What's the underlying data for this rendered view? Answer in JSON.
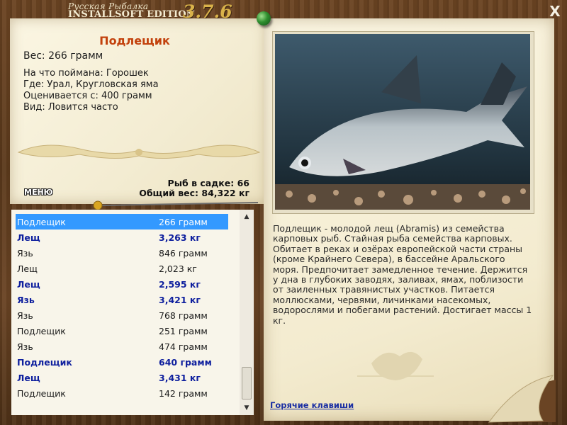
{
  "header": {
    "title_line1": "Русская Рыбалка",
    "title_line2": "INSTALLSOFT EDITION",
    "version": "3.7.6",
    "close": "X"
  },
  "catch": {
    "name": "Подлещик",
    "weight": "Вес: 266 грамм",
    "details": [
      "На что поймана: Горошек",
      "Где: Урал, Кругловская яма",
      "Оценивается с: 400 грамм",
      "Вид: Ловится часто"
    ]
  },
  "stats": {
    "fish_count": "Рыб в садке: 66",
    "total_weight": "Общий вес: 84,322 кг"
  },
  "menu_label": "МЕНЮ",
  "list": [
    {
      "name": "Подлещик",
      "weight": "266 грамм",
      "bold": false,
      "selected": true
    },
    {
      "name": "Лещ",
      "weight": "3,263 кг",
      "bold": true,
      "selected": false
    },
    {
      "name": "Язь",
      "weight": "846 грамм",
      "bold": false,
      "selected": false
    },
    {
      "name": "Лещ",
      "weight": "2,023 кг",
      "bold": false,
      "selected": false
    },
    {
      "name": "Лещ",
      "weight": "2,595 кг",
      "bold": true,
      "selected": false
    },
    {
      "name": "Язь",
      "weight": "3,421 кг",
      "bold": true,
      "selected": false
    },
    {
      "name": "Язь",
      "weight": "768 грамм",
      "bold": false,
      "selected": false
    },
    {
      "name": "Подлещик",
      "weight": "251 грамм",
      "bold": false,
      "selected": false
    },
    {
      "name": "Язь",
      "weight": "474 грамм",
      "bold": false,
      "selected": false
    },
    {
      "name": "Подлещик",
      "weight": "640 грамм",
      "bold": true,
      "selected": false
    },
    {
      "name": "Лещ",
      "weight": "3,431 кг",
      "bold": true,
      "selected": false
    },
    {
      "name": "Подлещик",
      "weight": "142 грамм",
      "bold": false,
      "selected": false
    }
  ],
  "description": "Подлещик - молодой лещ (Abramis) из семейства карповых рыб. Стайная рыба семейства карповых. Обитает в реках и озёрах европейской части страны (кроме Крайнего Севера), в бассейне Аральского моря. Предпочитает замедленное течение. Держится у дна в глубоких заводях, заливах, ямах, поблизости от заиленных травянистых участков. Питается моллюсками, червями, личинками насекомых, водорослями и побегами растений. Достигает массы 1 кг.",
  "hotkeys_link": "Горячие клавиши",
  "colors": {
    "fish_name": "#c2410c",
    "bold_row": "#0e1f9e",
    "selected_row": "#3399ff",
    "link": "#1b2fa3"
  }
}
